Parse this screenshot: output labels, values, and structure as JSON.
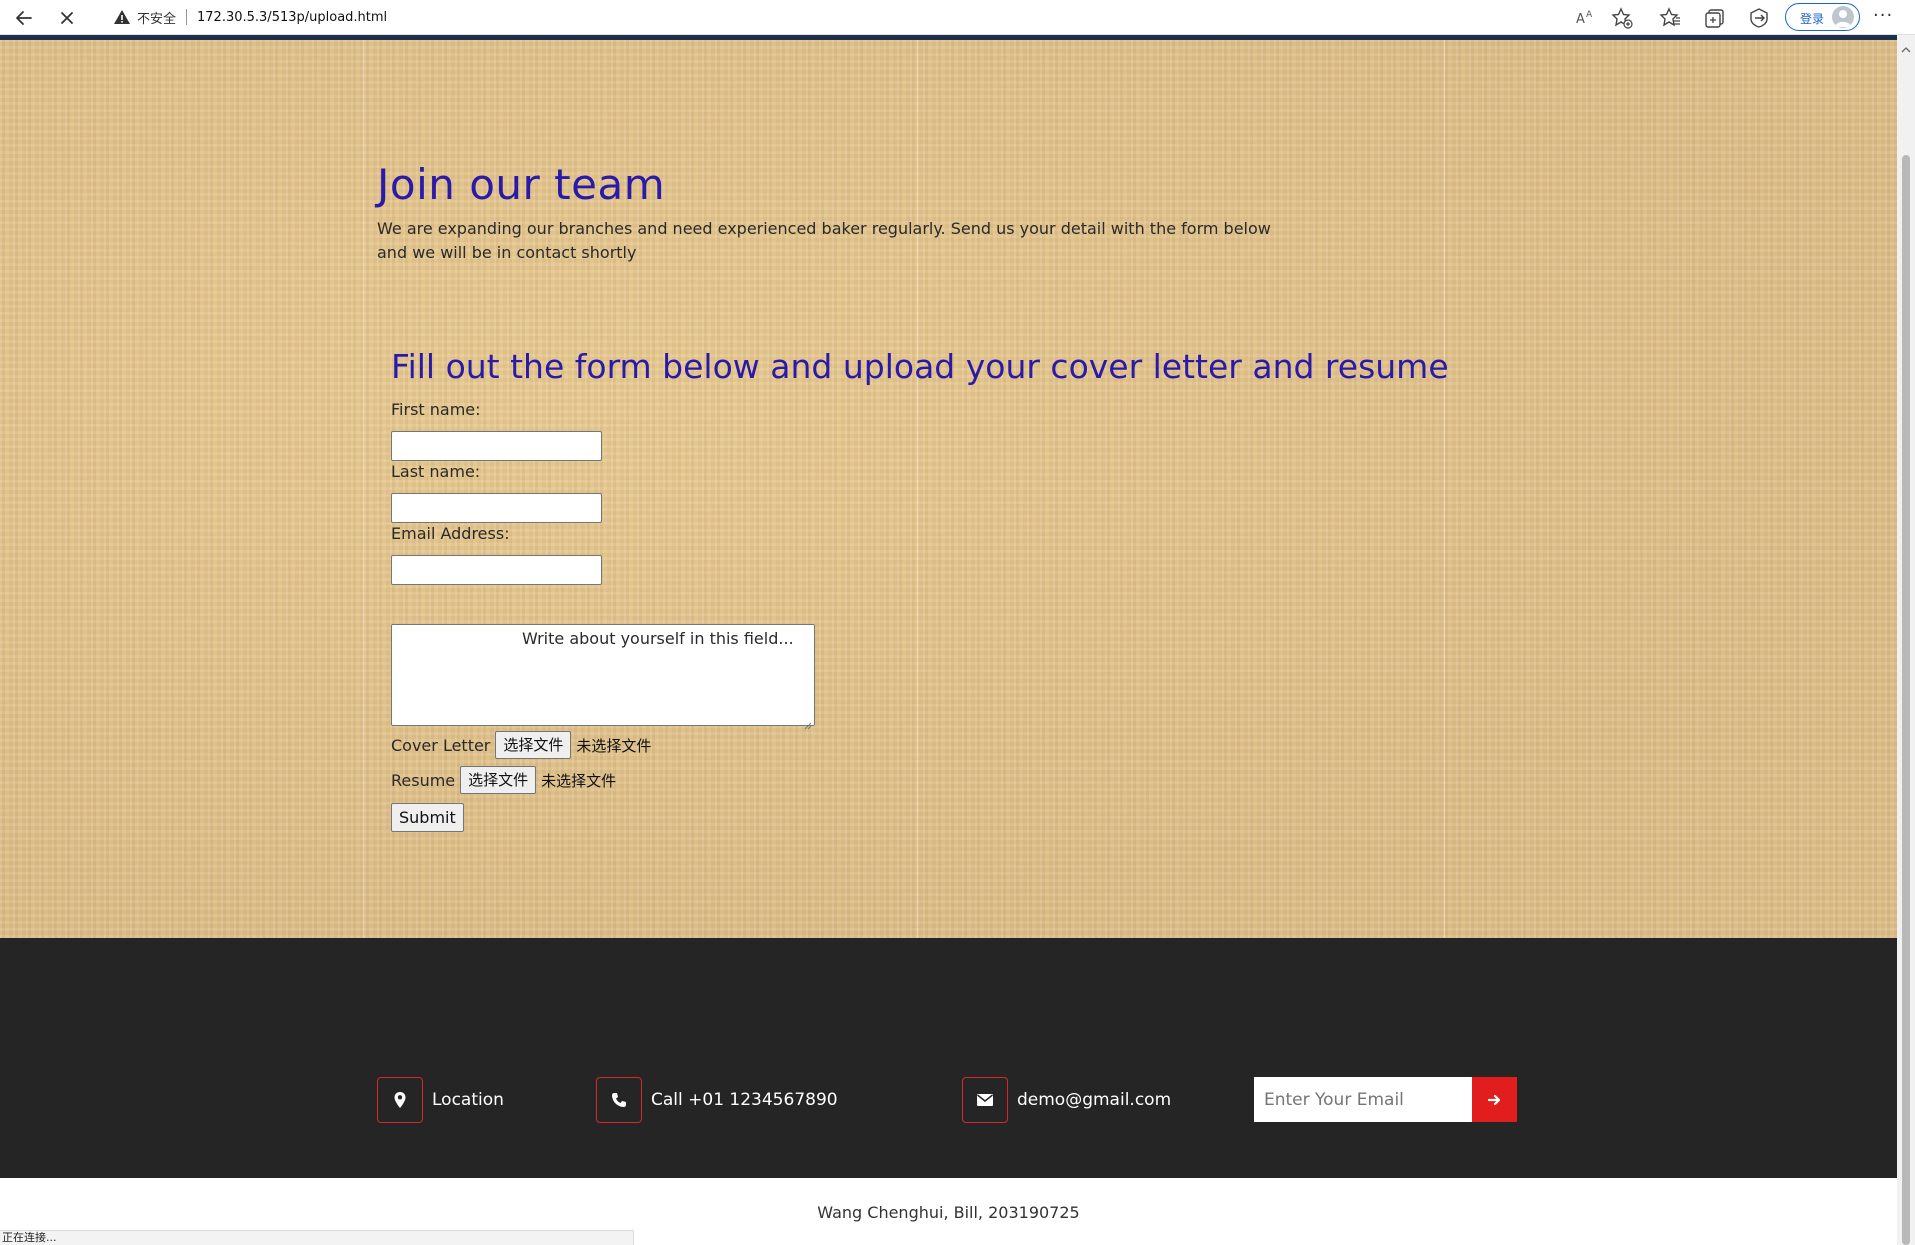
{
  "browser": {
    "security_label": "不安全",
    "url": "172.30.5.3/513p/upload.html",
    "login_label": "登录",
    "more_label": "···",
    "status_text": "正在连接..."
  },
  "page": {
    "heading": "Join our team",
    "intro": "We are expanding our branches and need experienced baker regularly. Send us your detail with the form below and we will be in contact shortly",
    "form": {
      "title": "Fill out the form below and upload your cover letter and resume",
      "first_name_label": "First name:",
      "first_name_value": "",
      "last_name_label": "Last name:",
      "last_name_value": "",
      "email_label": "Email Address:",
      "email_value": "",
      "about_placeholder": "Write about yourself in this field...",
      "cover_letter_label": "Cover Letter",
      "resume_label": "Resume",
      "choose_file_label": "选择文件",
      "no_file_label": "未选择文件",
      "submit_label": "Submit"
    }
  },
  "footer": {
    "location_label": "Location",
    "phone_label": "Call +01 1234567890",
    "email_label": "demo@gmail.com",
    "newsletter_placeholder": "Enter Your Email",
    "accent_color": "#e21d1d",
    "copyright": "Wang Chenghui, Bill, 203190725"
  }
}
